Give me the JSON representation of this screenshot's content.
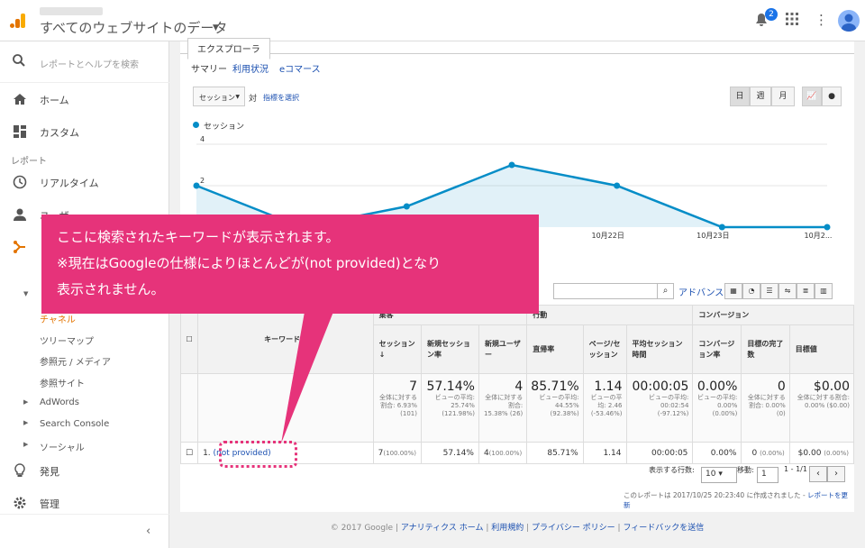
{
  "header": {
    "property_title": "すべてのウェブサイトのデータ",
    "notification_count": "2"
  },
  "sidebar": {
    "search_placeholder": "レポートとヘルプを検索",
    "home": "ホーム",
    "custom": "カスタム",
    "reports_label": "レポート",
    "realtime": "リアルタイム",
    "audience_partial": "ユーザー",
    "channels": "チャネル",
    "treemap": "ツリーマップ",
    "source_medium": "参照元 / メディア",
    "referrals": "参照サイト",
    "adwords": "AdWords",
    "search_console": "Search Console",
    "social": "ソーシャル",
    "discover": "発見",
    "admin": "管理"
  },
  "explorer": {
    "tab_label": "エクスプローラ",
    "subtabs": [
      "サマリー",
      "利用状況",
      "eコマース"
    ],
    "metric_select": "セッション",
    "vs": "対",
    "pick_metric": "指標を選択",
    "period_buttons": [
      "日",
      "週",
      "月"
    ],
    "legend_series": "セッション"
  },
  "chart_data": {
    "type": "area",
    "series": [
      {
        "name": "セッション",
        "values": [
          2,
          0,
          1,
          3,
          2,
          0,
          0
        ]
      }
    ],
    "x": [
      "",
      "",
      "",
      "",
      "10月22日",
      "10月23日",
      "10月2..."
    ],
    "yticks": [
      "4",
      "2"
    ],
    "ylim": [
      0,
      4
    ],
    "color": "#058dc7"
  },
  "table": {
    "advanced": "アドバンス",
    "keyword_header": "キーワード",
    "group_acq": "集客",
    "group_behavior": "行動",
    "group_conv": "コンバージョン",
    "columns": [
      "セッション",
      "新規セッション率",
      "新規ユーザー",
      "直帰率",
      "ページ/セッション",
      "平均セッション時間",
      "コンバージョン率",
      "目標の完了数",
      "目標値"
    ],
    "totals": [
      {
        "big": "7",
        "small": "全体に対する割合: 6.93% (101)"
      },
      {
        "big": "57.14%",
        "small": "ビューの平均: 25.74% (121.98%)"
      },
      {
        "big": "4",
        "small": "全体に対する割合: 15.38% (26)"
      },
      {
        "big": "85.71%",
        "small": "ビューの平均: 44.55% (92.38%)"
      },
      {
        "big": "1.14",
        "small": "ビューの平均: 2.46 (-53.46%)"
      },
      {
        "big": "00:00:05",
        "small": "ビューの平均: 00:02:54 (-97.12%)"
      },
      {
        "big": "0.00%",
        "small": "ビューの平均: 0.00% (0.00%)"
      },
      {
        "big": "0",
        "small": "全体に対する割合: 0.00% (0)"
      },
      {
        "big": "$0.00",
        "small": "全体に対する割合: 0.00% ($0.00)"
      }
    ],
    "row": {
      "index": "1.",
      "keyword": "(not provided)",
      "sessions": "7",
      "sessions_pct": "(100.00%)",
      "new_rate": "57.14%",
      "new_users": "4",
      "new_users_pct": "(100.00%)",
      "bounce": "85.71%",
      "pps": "1.14",
      "avg_time": "00:00:05",
      "conv_rate": "0.00%",
      "goals": "0",
      "goals_pct": "(0.00%)",
      "value": "$0.00",
      "value_pct": "(0.00%)"
    },
    "rows_label": "表示する行数:",
    "rows_value": "10",
    "goto_label": "移動:",
    "goto_value": "1",
    "range": "1 - 1/1",
    "created_note": "このレポートは 2017/10/25 20:23:40 に作成されました - ",
    "refresh_link": "レポートを更新"
  },
  "footer": {
    "copyright": "© 2017 Google",
    "links": [
      "アナリティクス ホーム",
      "利用規約",
      "プライバシー ポリシー",
      "フィードバックを送信"
    ]
  },
  "callout": {
    "line1": "ここに検索されたキーワードが表示されます。",
    "line2": "※現在はGoogleの仕様によりほとんどが(not provided)となり",
    "line3": "表示されません。"
  },
  "colors": {
    "accent": "#e6337a",
    "series": "#058dc7",
    "link": "#1a4fb0"
  }
}
